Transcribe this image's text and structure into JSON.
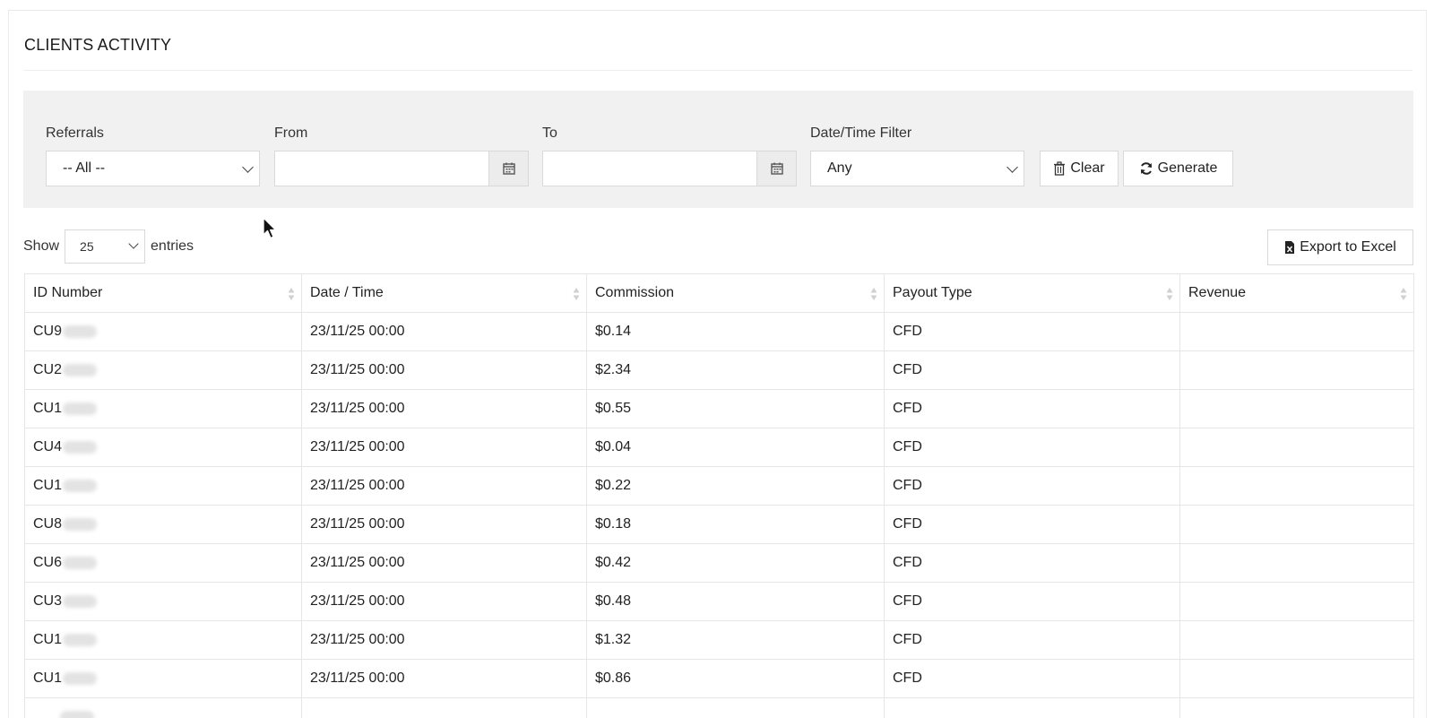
{
  "page_title": "CLIENTS ACTIVITY",
  "filters": {
    "referrals_label": "Referrals",
    "referrals_value": "-- All --",
    "from_label": "From",
    "from_value": "",
    "to_label": "To",
    "to_value": "",
    "datetime_filter_label": "Date/Time Filter",
    "datetime_filter_value": "Any",
    "clear_label": "Clear",
    "generate_label": "Generate"
  },
  "table_controls": {
    "show_label": "Show",
    "entries_value": "25",
    "entries_label": "entries",
    "export_label": "Export to Excel"
  },
  "table": {
    "headers": [
      "ID Number",
      "Date / Time",
      "Commission",
      "Payout Type",
      "Revenue"
    ],
    "rows": [
      {
        "id": "CU9",
        "datetime": "23/11/25 00:00",
        "commission": "$0.14",
        "payout_type": "CFD",
        "revenue": ""
      },
      {
        "id": "CU2",
        "datetime": "23/11/25 00:00",
        "commission": "$2.34",
        "payout_type": "CFD",
        "revenue": ""
      },
      {
        "id": "CU1",
        "datetime": "23/11/25 00:00",
        "commission": "$0.55",
        "payout_type": "CFD",
        "revenue": ""
      },
      {
        "id": "CU4",
        "datetime": "23/11/25 00:00",
        "commission": "$0.04",
        "payout_type": "CFD",
        "revenue": ""
      },
      {
        "id": "CU1",
        "datetime": "23/11/25 00:00",
        "commission": "$0.22",
        "payout_type": "CFD",
        "revenue": ""
      },
      {
        "id": "CU8",
        "datetime": "23/11/25 00:00",
        "commission": "$0.18",
        "payout_type": "CFD",
        "revenue": ""
      },
      {
        "id": "CU6",
        "datetime": "23/11/25 00:00",
        "commission": "$0.42",
        "payout_type": "CFD",
        "revenue": ""
      },
      {
        "id": "CU3",
        "datetime": "23/11/25 00:00",
        "commission": "$0.48",
        "payout_type": "CFD",
        "revenue": ""
      },
      {
        "id": "CU1",
        "datetime": "23/11/25 00:00",
        "commission": "$1.32",
        "payout_type": "CFD",
        "revenue": ""
      },
      {
        "id": "CU1",
        "datetime": "23/11/25 00:00",
        "commission": "$0.86",
        "payout_type": "CFD",
        "revenue": ""
      }
    ]
  },
  "icons": {
    "calendar": "calendar-icon",
    "trash": "trash-icon",
    "refresh": "refresh-icon",
    "excel": "excel-file-icon",
    "sort": "sort-icon",
    "cursor": "mouse-cursor-icon"
  }
}
